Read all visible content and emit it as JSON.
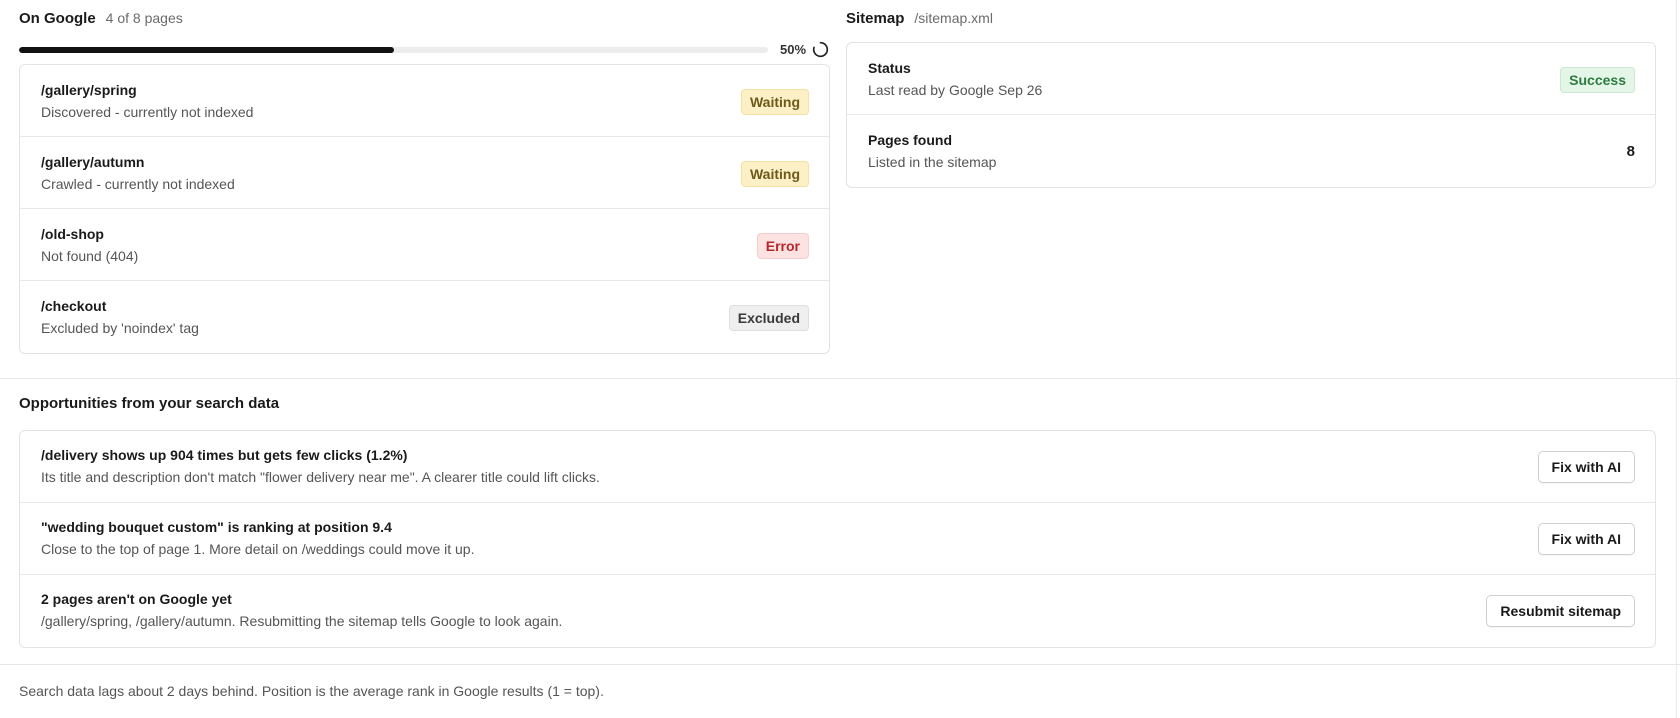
{
  "on_google": {
    "title": "On Google",
    "count_text": "4 of 8 pages",
    "progress_percent": 50,
    "progress_label": "50%",
    "spinner_icon": "loading-spinner-icon",
    "pages": [
      {
        "path": "/gallery/spring",
        "status_text": "Discovered - currently not indexed",
        "badge": "Waiting"
      },
      {
        "path": "/gallery/autumn",
        "status_text": "Crawled - currently not indexed",
        "badge": "Waiting"
      },
      {
        "path": "/old-shop",
        "status_text": "Not found (404)",
        "badge": "Error"
      },
      {
        "path": "/checkout",
        "status_text": "Excluded by 'noindex' tag",
        "badge": "Excluded"
      }
    ]
  },
  "sitemap": {
    "title": "Sitemap",
    "path": "/sitemap.xml",
    "status_label": "Status",
    "status_sub": "Last read by Google Sep 26",
    "status_badge": "Success",
    "pages_found_label": "Pages found",
    "pages_found_sub": "Listed in the sitemap",
    "pages_found_value": "8"
  },
  "opportunities": {
    "heading": "Opportunities from your search data",
    "items": [
      {
        "title": "/delivery shows up 904 times but gets few clicks (1.2%)",
        "description": "Its title and description don't match \"flower delivery near me\". A clearer title could lift clicks.",
        "action": "Fix with AI"
      },
      {
        "title": "\"wedding bouquet custom\" is ranking at position 9.4",
        "description": "Close to the top of page 1. More detail on /weddings could move it up.",
        "action": "Fix with AI"
      },
      {
        "title": "2 pages aren't on Google yet",
        "description": "/gallery/spring, /gallery/autumn. Resubmitting the sitemap tells Google to look again.",
        "action": "Resubmit sitemap"
      }
    ]
  },
  "footer": {
    "note": "Search data lags about 2 days behind. Position is the average rank in Google results (1 = top)."
  },
  "colors": {
    "progress_fill": "#121212",
    "waiting_bg": "#fdf0c6",
    "error_bg": "#fde2e2",
    "excluded_bg": "#efefef",
    "success_bg": "#e4f6e7"
  }
}
